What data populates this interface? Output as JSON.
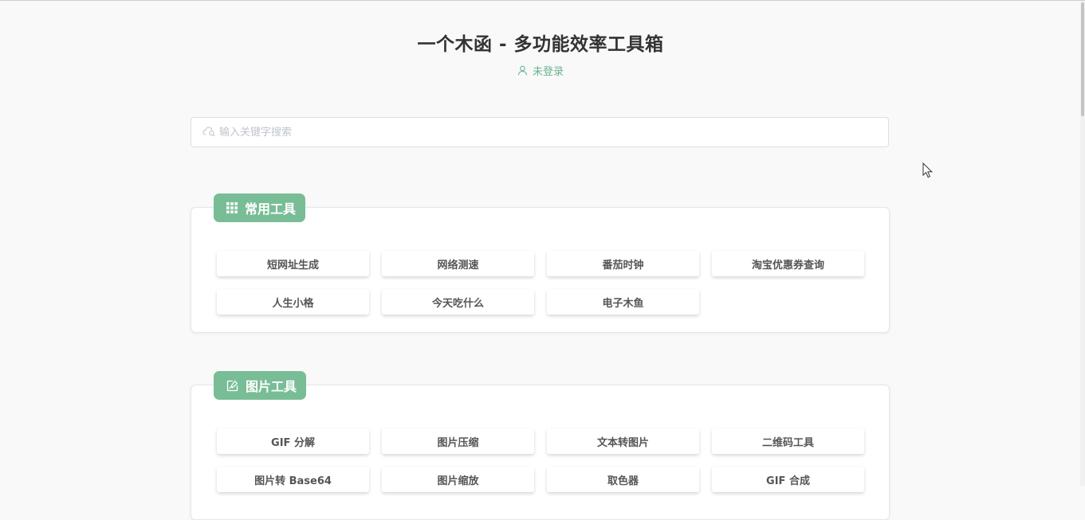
{
  "header": {
    "title": "一个木函 - 多功能效率工具箱",
    "login_status": "未登录"
  },
  "search": {
    "placeholder": "输入关键字搜索",
    "value": ""
  },
  "sections": [
    {
      "title": "常用工具",
      "icon": "grid-icon",
      "tools": [
        "短网址生成",
        "网络测速",
        "番茄时钟",
        "淘宝优惠券查询",
        "人生小格",
        "今天吃什么",
        "电子木鱼"
      ]
    },
    {
      "title": "图片工具",
      "icon": "image-edit-icon",
      "tools": [
        "GIF 分解",
        "图片压缩",
        "文本转图片",
        "二维码工具",
        "图片转 Base64",
        "图片缩放",
        "取色器",
        "GIF 合成"
      ]
    }
  ],
  "colors": {
    "accent": "#79bd96",
    "accent_text": "#6ab38f",
    "background": "#f9f9f9"
  }
}
